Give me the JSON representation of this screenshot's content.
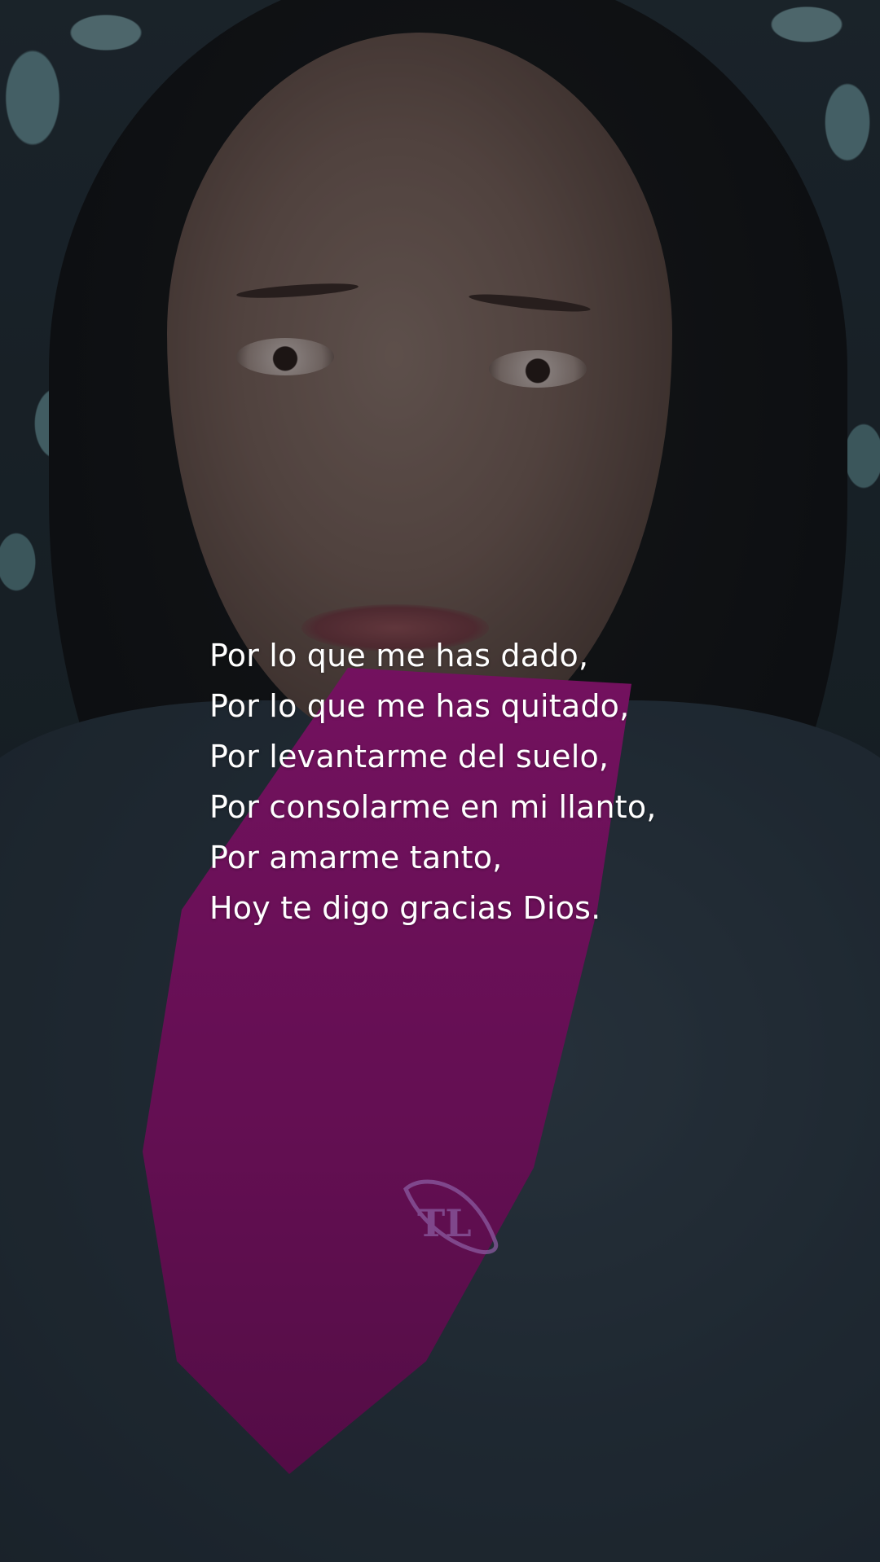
{
  "poem": {
    "lines": [
      "Por lo que me has dado,",
      "Por lo que me has quitado,",
      "Por levantarme del suelo,",
      "Por consolarme en mi llanto,",
      "Por amarme tanto,",
      "Hoy te digo gracias Dios."
    ]
  },
  "watermark": {
    "icon": "tl-logo-icon",
    "text": "TL",
    "color": "#8a5aa0"
  },
  "colors": {
    "text": "#ffffff",
    "magenta": "#c01496",
    "sweater": "#2e3b47",
    "wallpaper_accent": "#6f9aa0"
  }
}
